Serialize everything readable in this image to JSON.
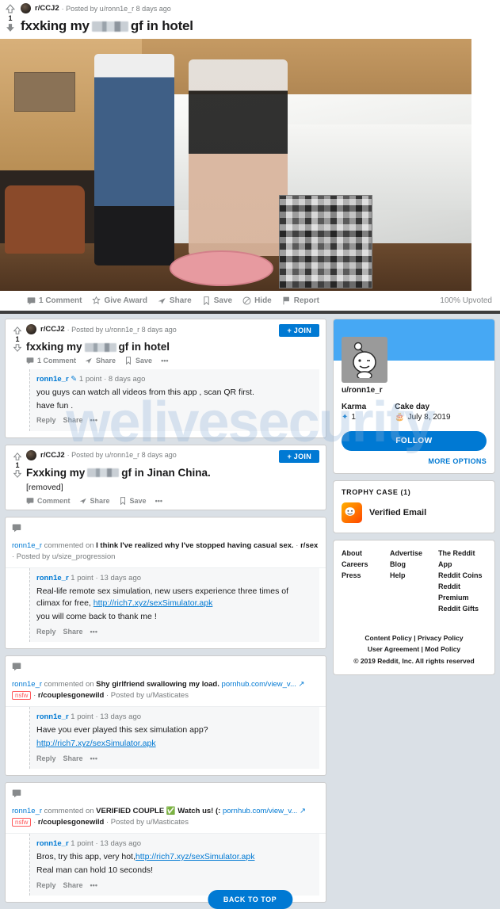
{
  "detail": {
    "vote_score": "1",
    "subreddit": "r/CCJ2",
    "posted_by": "· Posted by u/ronn1e_r 8 days ago",
    "title_before": "fxxking my",
    "title_after": "gf in hotel",
    "actions": [
      {
        "label": "1 Comment",
        "icon": "comment-icon"
      },
      {
        "label": "Give Award",
        "icon": "award-icon"
      },
      {
        "label": "Share",
        "icon": "share-icon"
      },
      {
        "label": "Save",
        "icon": "save-icon"
      },
      {
        "label": "Hide",
        "icon": "hide-icon"
      },
      {
        "label": "Report",
        "icon": "report-icon"
      }
    ],
    "upvoted": "100% Upvoted"
  },
  "watermark": "welivesecurity",
  "feed": {
    "posts": [
      {
        "vote_score": "1",
        "subreddit": "r/CCJ2",
        "posted_by": "· Posted by u/ronn1e_r 8 days ago",
        "join_label": "+ JOIN",
        "title_before": "fxxking my",
        "title_after": "gf in hotel",
        "body": "",
        "actions": [
          "1 Comment",
          "Share",
          "Save",
          "•••"
        ],
        "comment": {
          "user": "ronn1e_r",
          "points": "1 point",
          "age": "· 8 days ago",
          "lines": [
            "you guys can watch all videos from this app , scan QR first.",
            "have fun ."
          ],
          "actions": [
            "Reply",
            "Share",
            "•••"
          ]
        }
      },
      {
        "vote_score": "1",
        "subreddit": "r/CCJ2",
        "posted_by": "· Posted by u/ronn1e_r 8 days ago",
        "join_label": "+ JOIN",
        "title_before": "Fxxking my",
        "title_after": "gf in Jinan China.",
        "body": "[removed]",
        "actions": [
          "Comment",
          "Share",
          "Save",
          "•••"
        ]
      }
    ],
    "comment_cards": [
      {
        "head_user": "ronn1e_r",
        "head_verb": "commented on",
        "head_post": "I think I've realized why I've stopped having casual sex.",
        "head_sep": "·",
        "head_sub": "r/sex",
        "head_tail": "· Posted by u/size_progression",
        "link_text": "",
        "nsfw": "",
        "user": "ronn1e_r",
        "points": "1 point",
        "age": "· 13 days ago",
        "body_pre": "Real-life remote sex simulation, new users experience three times of climax for free,",
        "body_link": "http://rich7.xyz/sexSimulator.apk",
        "body_post": "you will come back to thank me !",
        "actions": [
          "Reply",
          "Share",
          "•••"
        ]
      },
      {
        "head_user": "ronn1e_r",
        "head_verb": "commented on",
        "head_post": "Shy girlfriend swallowing my load.",
        "head_sep": "·",
        "head_sub": "r/couplesgonewild",
        "head_tail": "· Posted by u/Masticates",
        "link_text": "pornhub.com/view_v...",
        "nsfw": "nsfw",
        "user": "ronn1e_r",
        "points": "1 point",
        "age": "· 13 days ago",
        "body_pre": "Have you ever played this sex simulation app?",
        "body_link": "http://rich7.xyz/sexSimulator.apk",
        "body_post": "",
        "actions": [
          "Reply",
          "Share",
          "•••"
        ]
      },
      {
        "head_user": "ronn1e_r",
        "head_verb": "commented on",
        "head_post": "VERIFIED COUPLE ✅ Watch us! (:",
        "head_sep": "·",
        "head_sub": "r/couplesgonewild",
        "head_tail": "· Posted by u/Masticates",
        "link_text": "pornhub.com/view_v...",
        "nsfw": "nsfw",
        "user": "ronn1e_r",
        "points": "1 point",
        "age": "· 13 days ago",
        "body_pre": "Bros, try this app, very hot,",
        "body_link": "http://rich7.xyz/sexSimulator.apk",
        "body_post": "Real man can hold 10 seconds!",
        "actions": [
          "Reply",
          "Share",
          "•••"
        ]
      }
    ]
  },
  "sidebar": {
    "username": "u/ronn1e_r",
    "karma_label": "Karma",
    "karma_value": "1",
    "cakeday_label": "Cake day",
    "cakeday_value": "July 8, 2019",
    "follow_label": "FOLLOW",
    "more_options": "MORE OPTIONS",
    "trophy_head": "TROPHY CASE (1)",
    "trophy_name": "Verified Email",
    "footer_col1": [
      "About",
      "Careers",
      "Press"
    ],
    "footer_col2": [
      "Advertise",
      "Blog",
      "Help"
    ],
    "footer_col3": [
      "The Reddit App",
      "Reddit Coins",
      "Reddit Premium",
      "Reddit Gifts"
    ],
    "legal": [
      "Content Policy |  Privacy Policy",
      "User Agreement |  Mod Policy",
      "© 2019 Reddit, Inc. All rights reserved"
    ],
    "back_to_top": "BACK TO TOP"
  },
  "colors": {
    "reddit_blue": "#0079d3",
    "banner_blue": "#46a8f4",
    "page_bg": "#dae0e6",
    "nsfw_red": "#ff585b"
  }
}
